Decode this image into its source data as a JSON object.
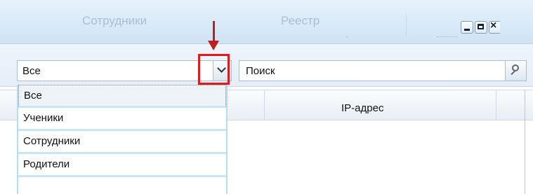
{
  "window": {
    "tabs": [
      {
        "label": "Сотрудники"
      },
      {
        "label": "Реестр"
      }
    ],
    "controls": [
      "minimize-icon",
      "maximize-icon",
      "close-icon"
    ]
  },
  "filter": {
    "selected": "Все",
    "options": [
      "Все",
      "Ученики",
      "Сотрудники",
      "Родители"
    ]
  },
  "search": {
    "value": "Поиск"
  },
  "table": {
    "columns": [
      "IP-адрес"
    ]
  },
  "colors": {
    "highlight": "#e0191d",
    "arrow": "#c21d1d"
  }
}
